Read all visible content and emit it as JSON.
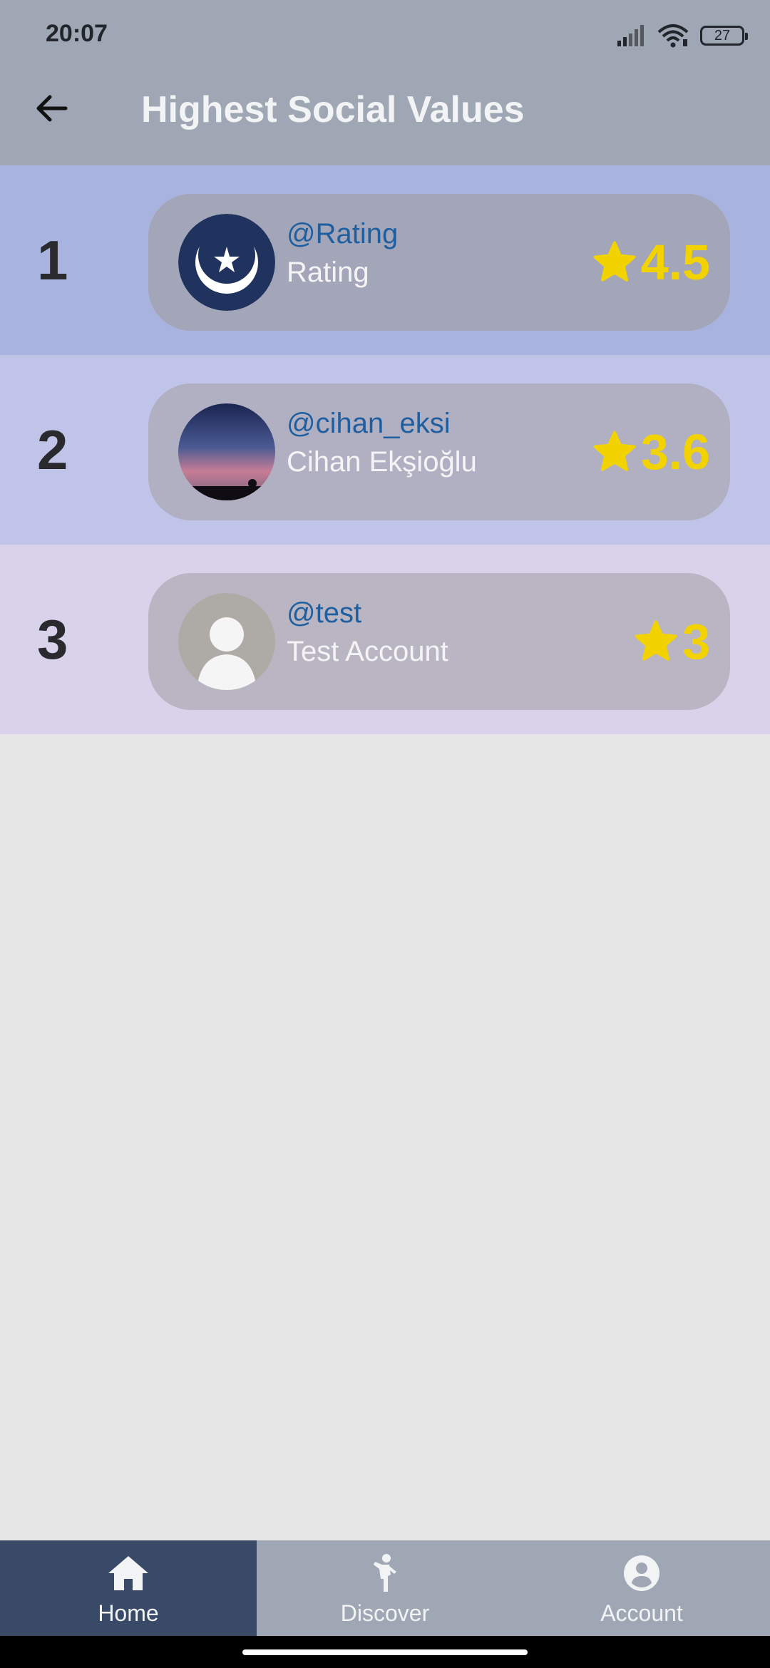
{
  "status_bar": {
    "time": "20:07",
    "battery": "27"
  },
  "header": {
    "title": "Highest Social Values"
  },
  "leaderboard": [
    {
      "rank": "1",
      "username": "@Rating",
      "name": "Rating",
      "score": "4.5",
      "avatar": "crescent-star-logo"
    },
    {
      "rank": "2",
      "username": "@cihan_eksi",
      "name": "Cihan Ekşioğlu",
      "score": "3.6",
      "avatar": "sunset-photo"
    },
    {
      "rank": "3",
      "username": "@test",
      "name": "Test Account",
      "score": "3",
      "avatar": "default-person"
    }
  ],
  "bottom_nav": [
    {
      "label": "Home",
      "icon": "home-icon",
      "active": true
    },
    {
      "label": "Discover",
      "icon": "walking-person-icon",
      "active": false
    },
    {
      "label": "Account",
      "icon": "account-circle-icon",
      "active": false
    }
  ],
  "colors": {
    "header_bg": "#9ea7b3",
    "row1_bg": "#a9b3df",
    "row2_bg": "#bfc4e8",
    "row3_bg": "#d8d2ea",
    "username": "#1f5fa0",
    "star": "#f2d300",
    "nav_active": "#384a68"
  }
}
